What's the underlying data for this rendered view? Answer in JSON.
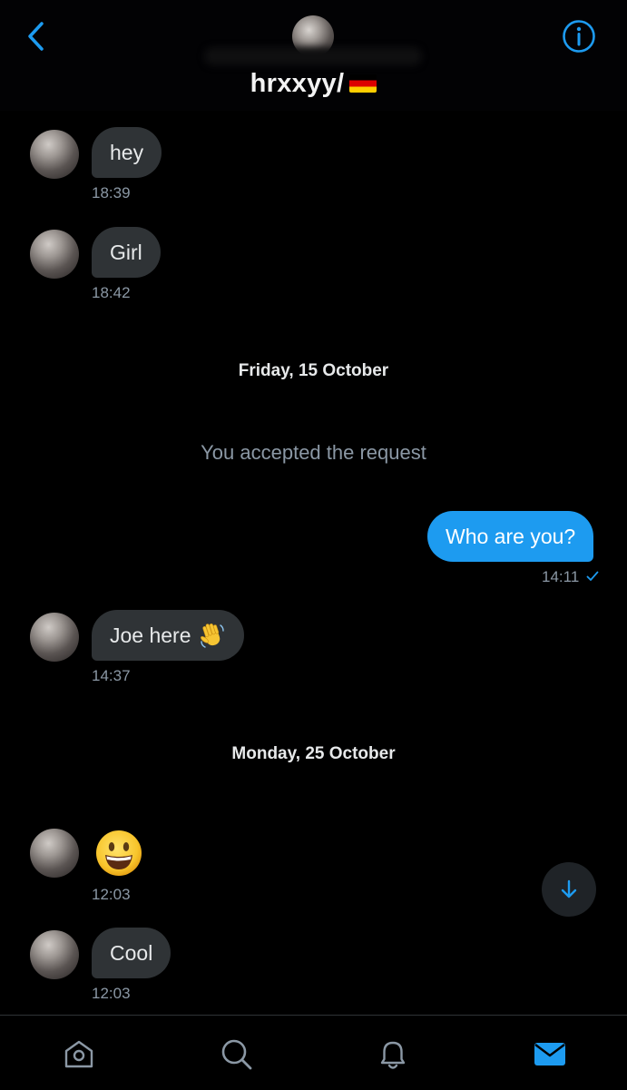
{
  "header": {
    "title": "hrxxyy/",
    "flag_icon": "germany-flag-icon",
    "back_icon": "chevron-left-icon",
    "info_icon": "info-icon",
    "accent": "#1d9bf0"
  },
  "messages": [
    {
      "text": "hey",
      "time": "18:39"
    },
    {
      "text": "Girl",
      "time": "18:42"
    },
    {
      "text": "Who are you?",
      "time": "14:11",
      "status_icon": "check-icon"
    },
    {
      "text": "Joe here",
      "emoji_icon": "waving-hand-icon",
      "time": "14:37"
    },
    {
      "emoji_icon": "smiling-face-icon",
      "time": "12:03"
    },
    {
      "text": "Cool",
      "time": "12:03"
    }
  ],
  "date_separators": [
    "Friday, 15 October",
    "Monday, 25 October"
  ],
  "system_message": "You accepted the request",
  "scroll_button_icon": "arrow-down-icon",
  "tabbar": {
    "items": [
      {
        "icon": "home-icon",
        "active": false
      },
      {
        "icon": "search-icon",
        "active": false
      },
      {
        "icon": "bell-icon",
        "active": false
      },
      {
        "icon": "mail-icon",
        "active": true
      }
    ]
  },
  "colors": {
    "background": "#000000",
    "incoming_bubble": "#2f3336",
    "outgoing_bubble": "#1d9bf0",
    "secondary_text": "#8b98a5"
  }
}
